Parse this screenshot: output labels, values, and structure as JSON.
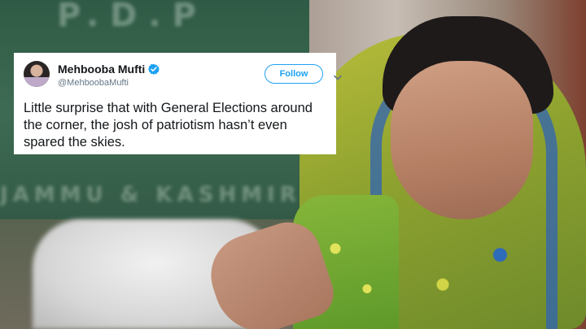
{
  "tweet": {
    "display_name": "Mehbooba Mufti",
    "handle": "@MehboobaMufti",
    "follow_label": "Follow",
    "text": "Little surprise that with General Elections around the corner, the josh of patriotism hasn’t even spared the skies.",
    "verified": true
  },
  "background": {
    "banner_text_top": "P.D.P",
    "banner_text_bottom": "JAMMU & KASHMIR"
  },
  "icons": {
    "verified": "verified-badge-icon",
    "menu": "chevron-down-icon"
  },
  "colors": {
    "twitter_blue": "#1da1f2",
    "text_primary": "#14171a",
    "text_secondary": "#657786",
    "card_background": "#ffffff"
  }
}
